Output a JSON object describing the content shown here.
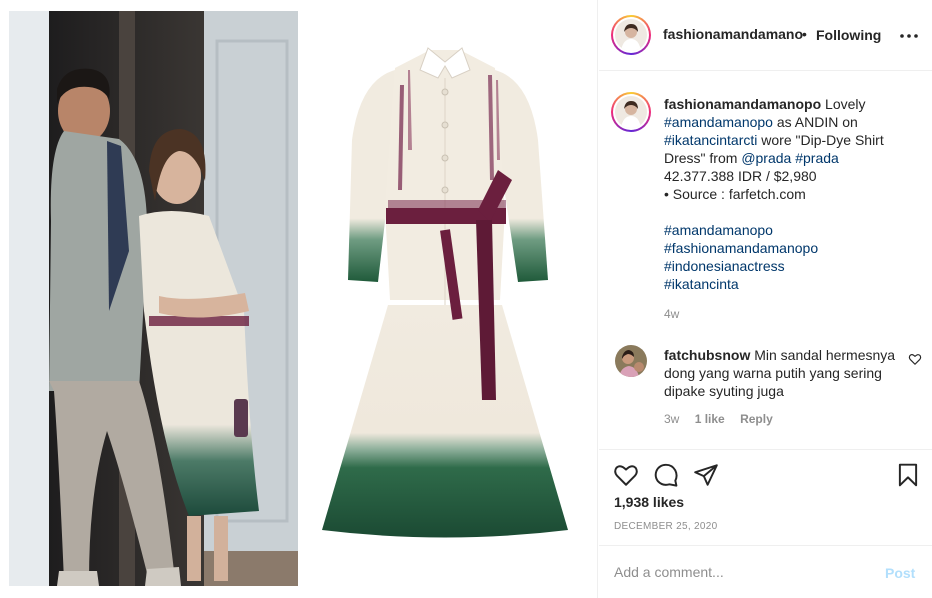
{
  "header": {
    "username": "fashionamandamano",
    "separator": "•",
    "follow_status": "Following",
    "more_icon": "more-horizontal-icon"
  },
  "caption": {
    "username": "fashionamandamanopo",
    "line1_text": "Lovely",
    "tag1": "#amandamanopo",
    "line2_text": "as ANDIN on",
    "tag2": "#ikatancintarcti",
    "line3_text": "wore \"Dip-Dye Shirt Dress\" from",
    "mention": "@prada",
    "tag3": "#prada",
    "price": "42.377.388 IDR / $2,980",
    "source": "• Source : farfetch.com",
    "hashtags": [
      "#amandamanopo",
      "#fashionamandamanopo",
      "#indonesianactress",
      "#ikatancinta"
    ],
    "time": "4w"
  },
  "comment": {
    "username": "fatchubsnow",
    "text": "Min sandal hermesnya dong yang warna putih yang sering dipake syuting juga",
    "time": "3w",
    "likes": "1 like",
    "reply": "Reply"
  },
  "actions": {
    "like_icon": "heart-icon",
    "comment_icon": "comment-icon",
    "share_icon": "paper-plane-icon",
    "save_icon": "bookmark-icon"
  },
  "likes": "1,938 likes",
  "date": "DECEMBER 25, 2020",
  "add_comment": {
    "placeholder": "Add a comment...",
    "post_label": "Post"
  },
  "colors": {
    "link": "#00376b",
    "muted": "#8e8e8e",
    "post_disabled": "#b2dffc",
    "dress_green": "#1f5a3a",
    "belt_plum": "#6b1f3e"
  }
}
